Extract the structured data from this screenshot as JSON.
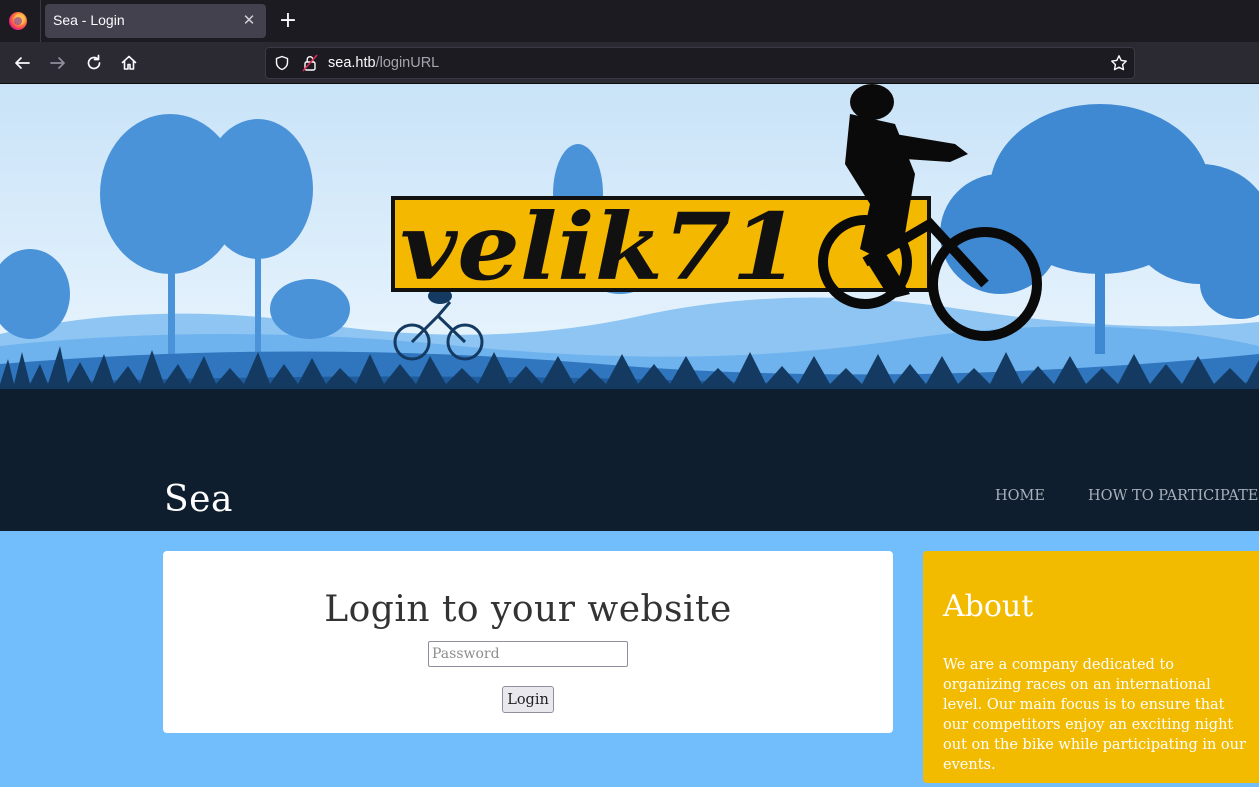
{
  "browser": {
    "tab_title": "Sea - Login",
    "tab_close_glyph": "✕",
    "new_tab_glyph": "+",
    "url_host": "sea.htb",
    "url_path": "/loginURL",
    "icons": [
      "firefox-logo",
      "back-icon",
      "forward-icon",
      "reload-icon",
      "home-icon",
      "shield-icon",
      "lock-icon",
      "star-icon"
    ]
  },
  "hero": {
    "logo_text": "velik71",
    "colors": {
      "sky": "#d7ecfb",
      "trees": "#4b93d8",
      "dark": "#0f1e2e",
      "logo_yellow": "#f5b800"
    }
  },
  "site": {
    "title": "Sea",
    "nav": {
      "home": "HOME",
      "how_to_participate": "HOW TO PARTICIPATE"
    }
  },
  "login": {
    "heading": "Login to your website",
    "password_placeholder": "Password",
    "button_label": "Login"
  },
  "about": {
    "heading": "About",
    "text": "We are a company dedicated to organizing races on an international level. Our main focus is to ensure that our competitors enjoy an exciting night out on the bike while participating in our events."
  }
}
